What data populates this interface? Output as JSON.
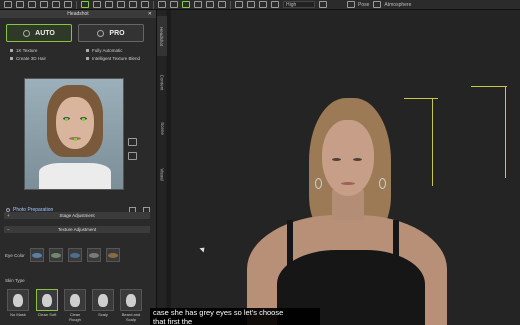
{
  "toolbar": {
    "quality_select": "High",
    "pose_label": "Pose",
    "atmosphere_label": "Atmosphere",
    "icons": [
      "new-icon",
      "open-icon",
      "save-icon",
      "import-icon",
      "export-icon",
      "settings-icon",
      "undo-icon",
      "redo-icon",
      "select-icon",
      "move-icon",
      "rotate-icon",
      "scale-icon",
      "camera-icon",
      "view-icon",
      "render-icon"
    ]
  },
  "panel": {
    "title": "Headshot",
    "modes": [
      {
        "label": "AUTO",
        "active": true
      },
      {
        "label": "PRO",
        "active": false
      }
    ],
    "options": [
      "1K Texture",
      "Fully Automatic",
      "Create 3D Hair",
      "Intelligent Texture Blend"
    ],
    "photo_preparation": "Photo Preparation",
    "stage_adjustment": "Stage Adjustment",
    "texture_adjustment": "Texture Adjustment",
    "eye_color_label": "Eye Color",
    "eye_colors": [
      "#5a7fa6",
      "#6f8a6a",
      "#4a6f8f",
      "#7a7a7a",
      "#8a6a45"
    ],
    "skin_type_label": "Skin Type",
    "skin_types": [
      {
        "label": "No Mask",
        "active": false
      },
      {
        "label": "Clean Soft",
        "active": true
      },
      {
        "label": "Clean Rough",
        "active": false
      },
      {
        "label": "Scaly",
        "active": false
      },
      {
        "label": "Beard and Scalp",
        "active": false
      }
    ]
  },
  "vtabs": [
    "Headshot",
    "Content",
    "Scene",
    "Visual"
  ],
  "subtitle": {
    "line1": "case she has grey eyes so let's choose",
    "line2": "that first the"
  }
}
